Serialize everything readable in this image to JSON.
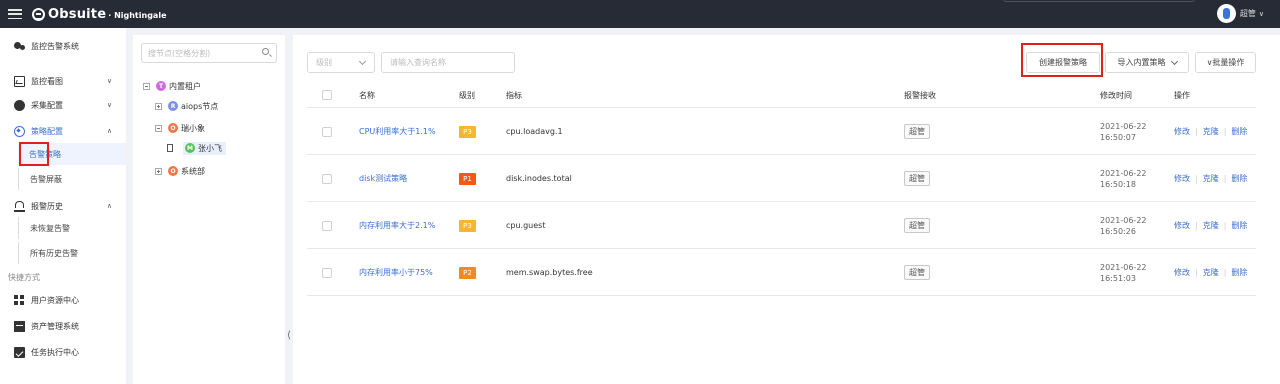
{
  "header": {
    "brand": "Obsuite",
    "brand_sub": "· Nightingale",
    "user_name": "超管",
    "user_caret": "∨"
  },
  "sidebar": {
    "title": "监控告警系统",
    "items": [
      {
        "label": "监控看图",
        "icon": "dashboard-icon",
        "expanded": false
      },
      {
        "label": "采集配置",
        "icon": "globe-icon",
        "expanded": false
      },
      {
        "label": "策略配置",
        "icon": "policy-icon",
        "expanded": true,
        "children": [
          "告警策略",
          "告警屏蔽"
        ]
      },
      {
        "label": "报警历史",
        "icon": "history-icon",
        "expanded": true,
        "children": [
          "未恢复告警",
          "所有历史告警"
        ]
      }
    ],
    "shortcut_label": "快捷方式",
    "shortcuts": [
      "用户资源中心",
      "资产管理系统",
      "任务执行中心"
    ],
    "chev_down": "∨",
    "chev_up": "∧"
  },
  "tree": {
    "search_placeholder": "搜节点(空格分割)",
    "root": {
      "label": "内置租户",
      "badge": "T",
      "badge_color": "#d06adf"
    },
    "nodes": [
      {
        "label": "aiops节点",
        "badge": "R",
        "badge_color": "#7b8ee8"
      },
      {
        "label": "瑞小象",
        "badge": "O",
        "badge_color": "#f2764b"
      },
      {
        "label": "张小飞",
        "badge": "M",
        "badge_color": "#58c25a"
      },
      {
        "label": "系统部",
        "badge": "O",
        "badge_color": "#f2764b"
      }
    ],
    "collapse_glyph": "⟨"
  },
  "toolbar": {
    "level_placeholder": "级别",
    "name_placeholder": "请输入查询名称",
    "create_label": "创建报警策略",
    "import_label": "导入内置策略",
    "batch_label": "∨批量操作"
  },
  "table": {
    "columns": [
      "名称",
      "级别",
      "指标",
      "报警接收",
      "修改时间",
      "操作"
    ],
    "rows": [
      {
        "name": "CPU利用率大于1.1%",
        "level": "P3",
        "level_color": "#f5b731",
        "metric": "cpu.loadavg.1",
        "receiver": "超管",
        "date": "2021-06-22",
        "time": "16:50:07"
      },
      {
        "name": "disk测试策略",
        "level": "P1",
        "level_color": "#f25a14",
        "metric": "disk.inodes.total",
        "receiver": "超管",
        "date": "2021-06-22",
        "time": "16:50:18"
      },
      {
        "name": "内存利用率大于2.1%",
        "level": "P3",
        "level_color": "#f5b731",
        "metric": "cpu.guest",
        "receiver": "超管",
        "date": "2021-06-22",
        "time": "16:50:26"
      },
      {
        "name": "内存利用率小于75%",
        "level": "P2",
        "level_color": "#f28a1f",
        "metric": "mem.swap.bytes.free",
        "receiver": "超管",
        "date": "2021-06-22",
        "time": "16:51:03"
      }
    ],
    "actions": [
      "修改",
      "克隆",
      "删除"
    ],
    "action_sep": "|"
  }
}
